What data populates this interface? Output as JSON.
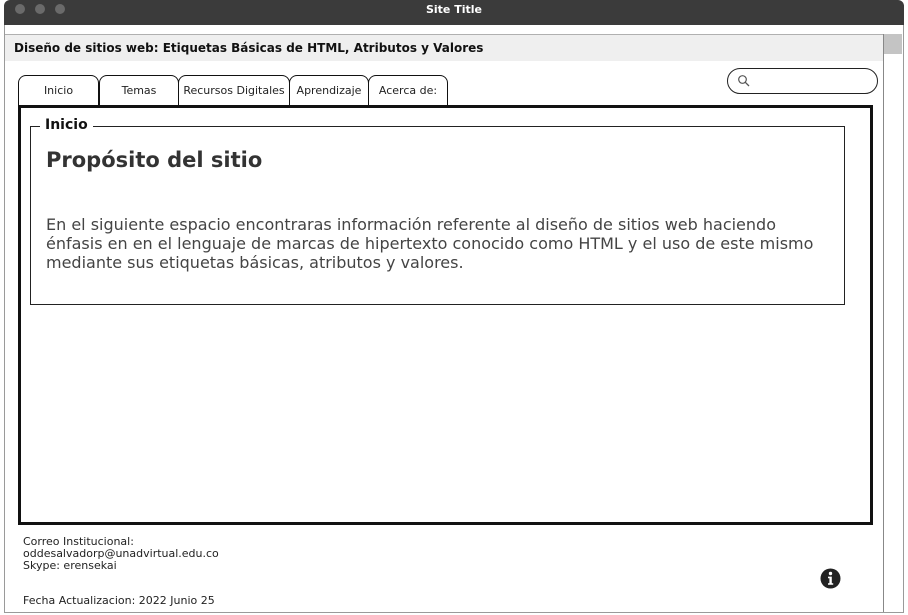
{
  "window": {
    "title": "Site Title"
  },
  "header": {
    "site_heading": "Diseño de sitios web: Etiquetas Básicas de HTML, Atributos y Valores"
  },
  "tabs": [
    {
      "label": "Inicio"
    },
    {
      "label": "Temas"
    },
    {
      "label": "Recursos Digitales"
    },
    {
      "label": "Aprendizaje"
    },
    {
      "label": "Acerca de:"
    }
  ],
  "search": {
    "placeholder": "",
    "value": "",
    "icon": "search-icon"
  },
  "content": {
    "section_legend": "Inicio",
    "heading": "Propósito del sitio",
    "body": "En el siguiente espacio encontraras información referente al diseño de sitios web haciendo énfasis en en el lenguaje de marcas de hipertexto conocido como HTML y el uso de este mismo mediante sus etiquetas básicas, atributos y valores."
  },
  "footer": {
    "email_label": "Correo Institucional:",
    "email": "oddesalvadorp@unadvirtual.edu.co",
    "skype": "Skype: erensekai",
    "updated": "Fecha Actualizacion: 2022 Junio 25",
    "info_icon": "info-icon"
  },
  "colors": {
    "titlebar": "#3b3b3b",
    "header_band": "#efefef",
    "border": "#111111"
  }
}
